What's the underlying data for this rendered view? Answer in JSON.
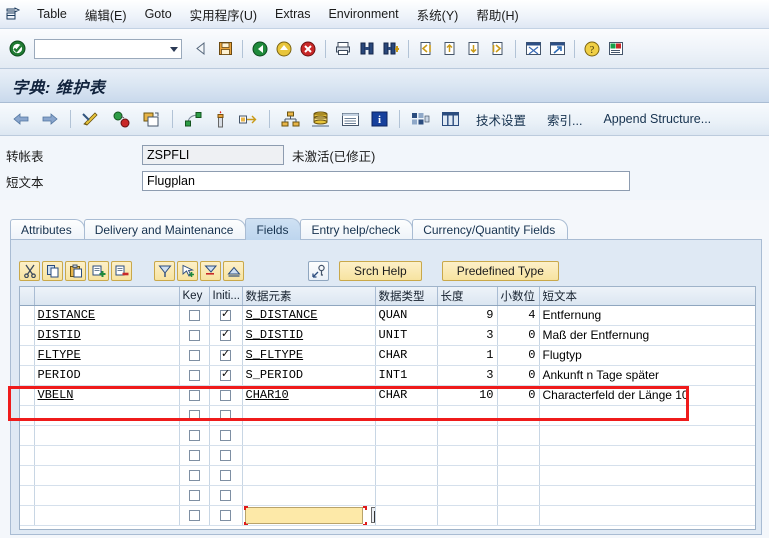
{
  "window": {
    "app_icon": "sap-table-icon"
  },
  "menubar": {
    "items": [
      {
        "label": "Table",
        "name": "menu-table"
      },
      {
        "label": "编辑(E)",
        "name": "menu-edit"
      },
      {
        "label": "Goto",
        "name": "menu-goto"
      },
      {
        "label": "实用程序(U)",
        "name": "menu-utilities"
      },
      {
        "label": "Extras",
        "name": "menu-extras"
      },
      {
        "label": "Environment",
        "name": "menu-environment"
      },
      {
        "label": "系统(Y)",
        "name": "menu-system"
      },
      {
        "label": "帮助(H)",
        "name": "menu-help"
      }
    ]
  },
  "toolbar": {
    "command_field": {
      "value": "",
      "placeholder": ""
    },
    "icons": [
      "enter-check-icon",
      "back-arrow-icon",
      "save-disk-icon",
      "back-green-icon",
      "exit-yellow-icon",
      "cancel-red-icon",
      "print-icon",
      "find-icon",
      "find-next-icon",
      "first-page-icon",
      "previous-page-icon",
      "next-page-icon",
      "last-page-icon",
      "new-session-icon",
      "create-shortcut-icon",
      "help-icon",
      "customize-layout-icon"
    ]
  },
  "title": {
    "text": "字典: 维护表"
  },
  "apptoolbar": {
    "icons": [
      "back-left-arrow-icon",
      "forward-right-arrow-icon",
      "display-change-pencil-icon",
      "check-activate-icon",
      "copy-object-icon",
      "extended-check-icon",
      "activate-torch-icon",
      "where-used-list-icon",
      "hierarchy-icon",
      "database-utility-icon",
      "list-display-icon",
      "info-icon",
      "table-layout-icon",
      "technical-settings-grid-icon"
    ],
    "buttons": [
      {
        "label": "技术设置",
        "name": "technical-settings-button"
      },
      {
        "label": "索引...",
        "name": "indexes-button"
      },
      {
        "label": "Append Structure...",
        "name": "append-structure-button"
      }
    ]
  },
  "form": {
    "table_label": "转帐表",
    "table_value": "ZSPFLI",
    "status_text": "未激活(已修正)",
    "shorttext_label": "短文本",
    "shorttext_value": "Flugplan"
  },
  "tabs": [
    {
      "label": "Attributes",
      "name": "tab-attributes",
      "active": false
    },
    {
      "label": "Delivery and Maintenance",
      "name": "tab-delivery-maintenance",
      "active": false
    },
    {
      "label": "Fields",
      "name": "tab-fields",
      "active": true
    },
    {
      "label": "Entry help/check",
      "name": "tab-entry-help-check",
      "active": false
    },
    {
      "label": "Currency/Quantity Fields",
      "name": "tab-currency-quantity-fields",
      "active": false
    }
  ],
  "alv_toolbar": {
    "icons": [
      "cut-scissors-icon",
      "copy-icon",
      "paste-icon",
      "insert-row-icon",
      "delete-row-icon",
      "append-row-icon",
      "insert-line-icon",
      "delete-line-icon",
      "expand-icon",
      "data-element-drilldown-icon"
    ],
    "buttons": [
      {
        "label": "Srch Help",
        "name": "search-help-button"
      },
      {
        "label": "Predefined Type",
        "name": "predefined-type-button"
      }
    ]
  },
  "grid": {
    "columns": [
      {
        "label": "",
        "name": "col-field"
      },
      {
        "label": "Key",
        "name": "col-key"
      },
      {
        "label": "Initi...",
        "name": "col-initial-values"
      },
      {
        "label": "数据元素",
        "name": "col-data-element"
      },
      {
        "label": "数据类型",
        "name": "col-data-type"
      },
      {
        "label": "长度",
        "name": "col-length"
      },
      {
        "label": "小数位",
        "name": "col-decimals"
      },
      {
        "label": "短文本",
        "name": "col-short-text"
      }
    ],
    "rows": [
      {
        "field": "DISTANCE",
        "key": false,
        "initial": true,
        "data_element": "S_DISTANCE",
        "data_type": "QUAN",
        "length": "9",
        "decimals": "4",
        "short_text": "Entfernung"
      },
      {
        "field": "DISTID",
        "key": false,
        "initial": true,
        "data_element": "S_DISTID",
        "data_type": "UNIT",
        "length": "3",
        "decimals": "0",
        "short_text": "Maß der Entfernung"
      },
      {
        "field": "FLTYPE",
        "key": false,
        "initial": true,
        "data_element": "S_FLTYPE",
        "data_type": "CHAR",
        "length": "1",
        "decimals": "0",
        "short_text": "Flugtyp"
      },
      {
        "field": "PERIOD",
        "key": false,
        "initial": true,
        "data_element": "S_PERIOD",
        "data_type": "INT1",
        "length": "3",
        "decimals": "0",
        "short_text": "Ankunft n Tage später"
      },
      {
        "field": "VBELN",
        "key": false,
        "initial": false,
        "data_element": "CHAR10",
        "data_type": "CHAR",
        "length": "10",
        "decimals": "0",
        "short_text": "Characterfeld der Länge 10",
        "highlighted": true
      },
      {
        "field": "",
        "key": false,
        "initial": false,
        "data_element": "",
        "data_type": "",
        "length": "",
        "decimals": "",
        "short_text": ""
      },
      {
        "field": "",
        "key": false,
        "initial": false,
        "data_element": "",
        "data_type": "",
        "length": "",
        "decimals": "",
        "short_text": ""
      },
      {
        "field": "",
        "key": false,
        "initial": false,
        "data_element": "",
        "data_type": "",
        "length": "",
        "decimals": "",
        "short_text": ""
      },
      {
        "field": "",
        "key": false,
        "initial": false,
        "data_element": "",
        "data_type": "",
        "length": "",
        "decimals": "",
        "short_text": ""
      },
      {
        "field": "",
        "key": false,
        "initial": false,
        "data_element": "",
        "data_type": "",
        "length": "",
        "decimals": "",
        "short_text": ""
      },
      {
        "field": "",
        "key": false,
        "initial": false,
        "data_element": "",
        "data_type": "",
        "length": "",
        "decimals": "",
        "short_text": "",
        "focused_input": true
      }
    ],
    "focused_cell": {
      "value": "",
      "placeholder": ""
    }
  },
  "annotation": {
    "highlight_color": "#ef1b1b",
    "target_row": "VBELN"
  },
  "colors": {
    "accent": "#1b4f8a",
    "button_yellow": "#f7e3a0",
    "focus_yellow": "#fde9a8",
    "annotation_red": "#ef1b1b"
  }
}
